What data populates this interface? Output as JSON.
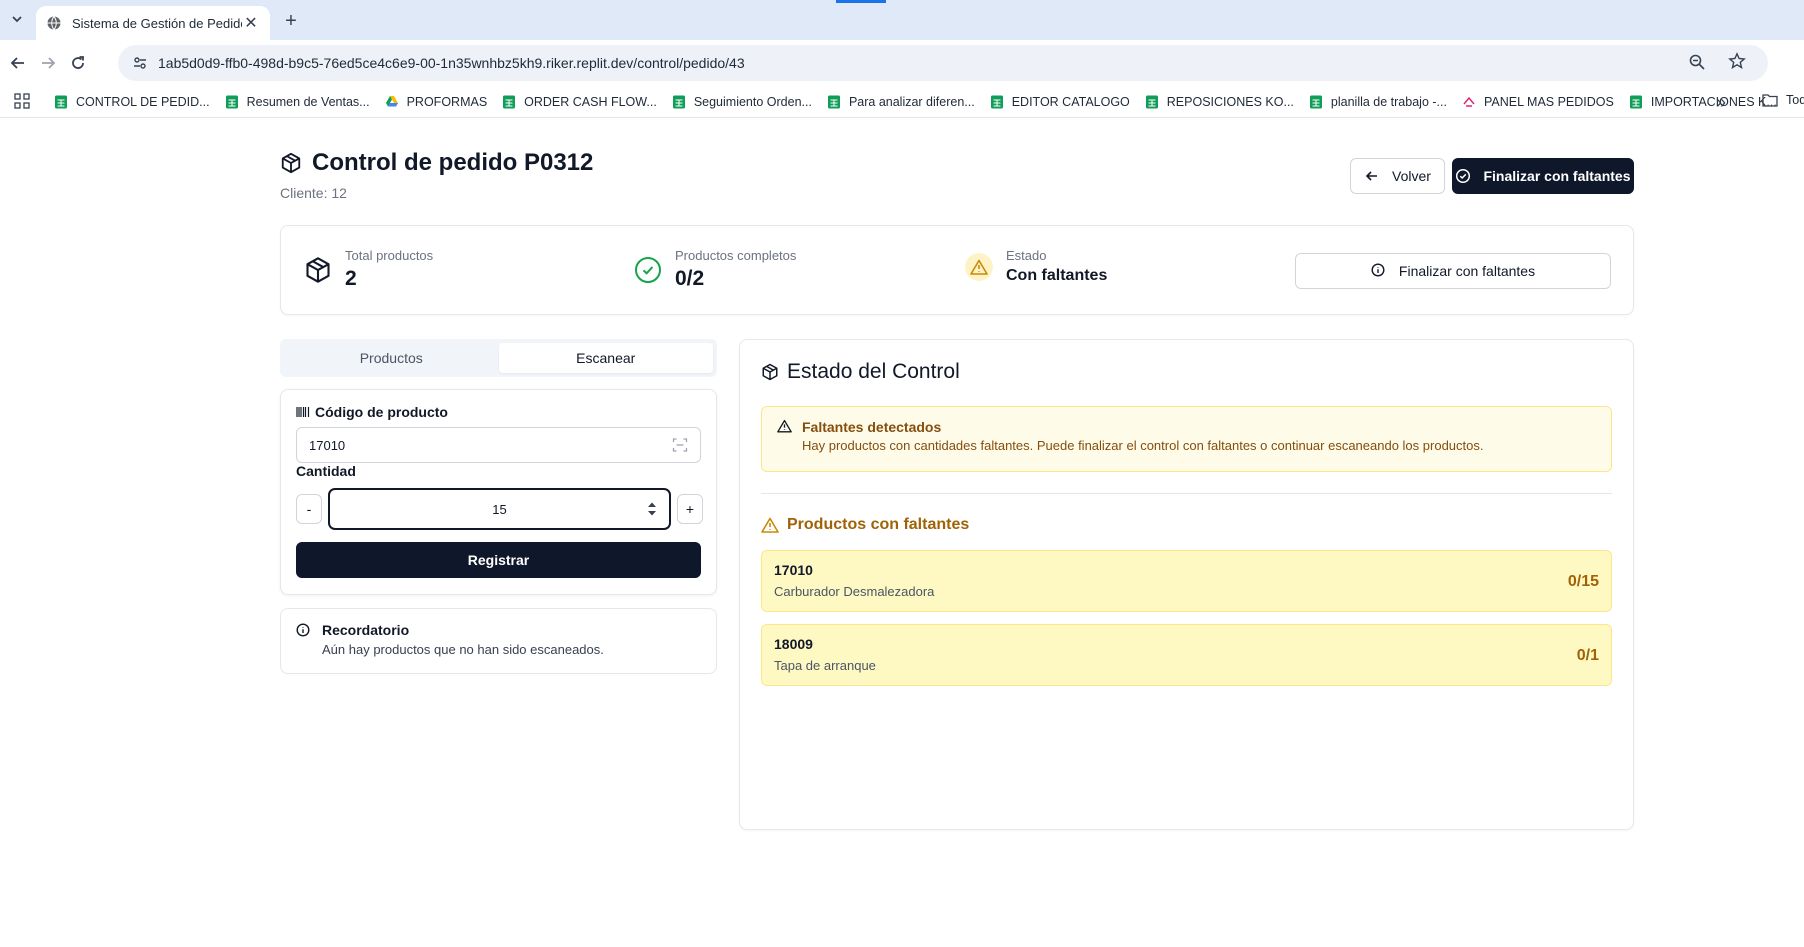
{
  "browser": {
    "tab_title": "Sistema de Gestión de Pedidos",
    "url": "1ab5d0d9-ffb0-498d-b9c5-76ed5ce4c6e9-00-1n35wnhbz5kh9.riker.replit.dev/control/pedido/43",
    "bookmarks": [
      {
        "label": "CONTROL DE PEDID...",
        "icon": "sheets-icon"
      },
      {
        "label": "Resumen de Ventas...",
        "icon": "sheets-icon"
      },
      {
        "label": "PROFORMAS",
        "icon": "drive-icon"
      },
      {
        "label": "ORDER CASH FLOW...",
        "icon": "sheets-icon"
      },
      {
        "label": "Seguimiento Orden...",
        "icon": "sheets-icon"
      },
      {
        "label": "Para analizar diferen...",
        "icon": "sheets-icon"
      },
      {
        "label": "EDITOR CATALOGO",
        "icon": "sheets-icon"
      },
      {
        "label": "REPOSICIONES KO...",
        "icon": "sheets-icon"
      },
      {
        "label": "planilla de trabajo -...",
        "icon": "sheets-icon"
      },
      {
        "label": "PANEL MAS PEDIDOS",
        "icon": "app-icon"
      },
      {
        "label": "IMPORTACIONES K...",
        "icon": "sheets-icon"
      }
    ],
    "bookmarks_more": "»",
    "bookmarks_folder": "Tod"
  },
  "header": {
    "title": "Control de pedido P0312",
    "client": "Cliente: 12",
    "back_label": "Volver",
    "finalize_label": "Finalizar con faltantes"
  },
  "summary": {
    "total_label": "Total productos",
    "total_value": "2",
    "complete_label": "Productos completos",
    "complete_value": "0/2",
    "state_label": "Estado",
    "state_value": "Con faltantes",
    "finalize_label": "Finalizar con faltantes"
  },
  "tabs": [
    {
      "label": "Productos",
      "active": false
    },
    {
      "label": "Escanear",
      "active": true
    }
  ],
  "scan_form": {
    "code_label": "Código de producto",
    "code_value": "17010",
    "qty_label": "Cantidad",
    "qty_value": "15",
    "minus": "-",
    "plus": "+",
    "submit_label": "Registrar"
  },
  "reminder": {
    "title": "Recordatorio",
    "text": "Aún hay productos que no han sido escaneados."
  },
  "state": {
    "title": "Estado del Control",
    "alert_title": "Faltantes detectados",
    "alert_text": "Hay productos con cantidades faltantes. Puede finalizar el control con faltantes o continuar escaneando los productos.",
    "missing_title": "Productos con faltantes",
    "items": [
      {
        "code": "17010",
        "name": "Carburador Desmalezadora",
        "count": "0/15"
      },
      {
        "code": "18009",
        "name": "Tapa de arranque",
        "count": "0/1"
      }
    ]
  },
  "colors": {
    "primary_dark": "#0f172a",
    "warning_bg": "#fef9c3",
    "warning_text": "#a16207",
    "success": "#16a34a",
    "sheets_green": "#0f9d58"
  }
}
